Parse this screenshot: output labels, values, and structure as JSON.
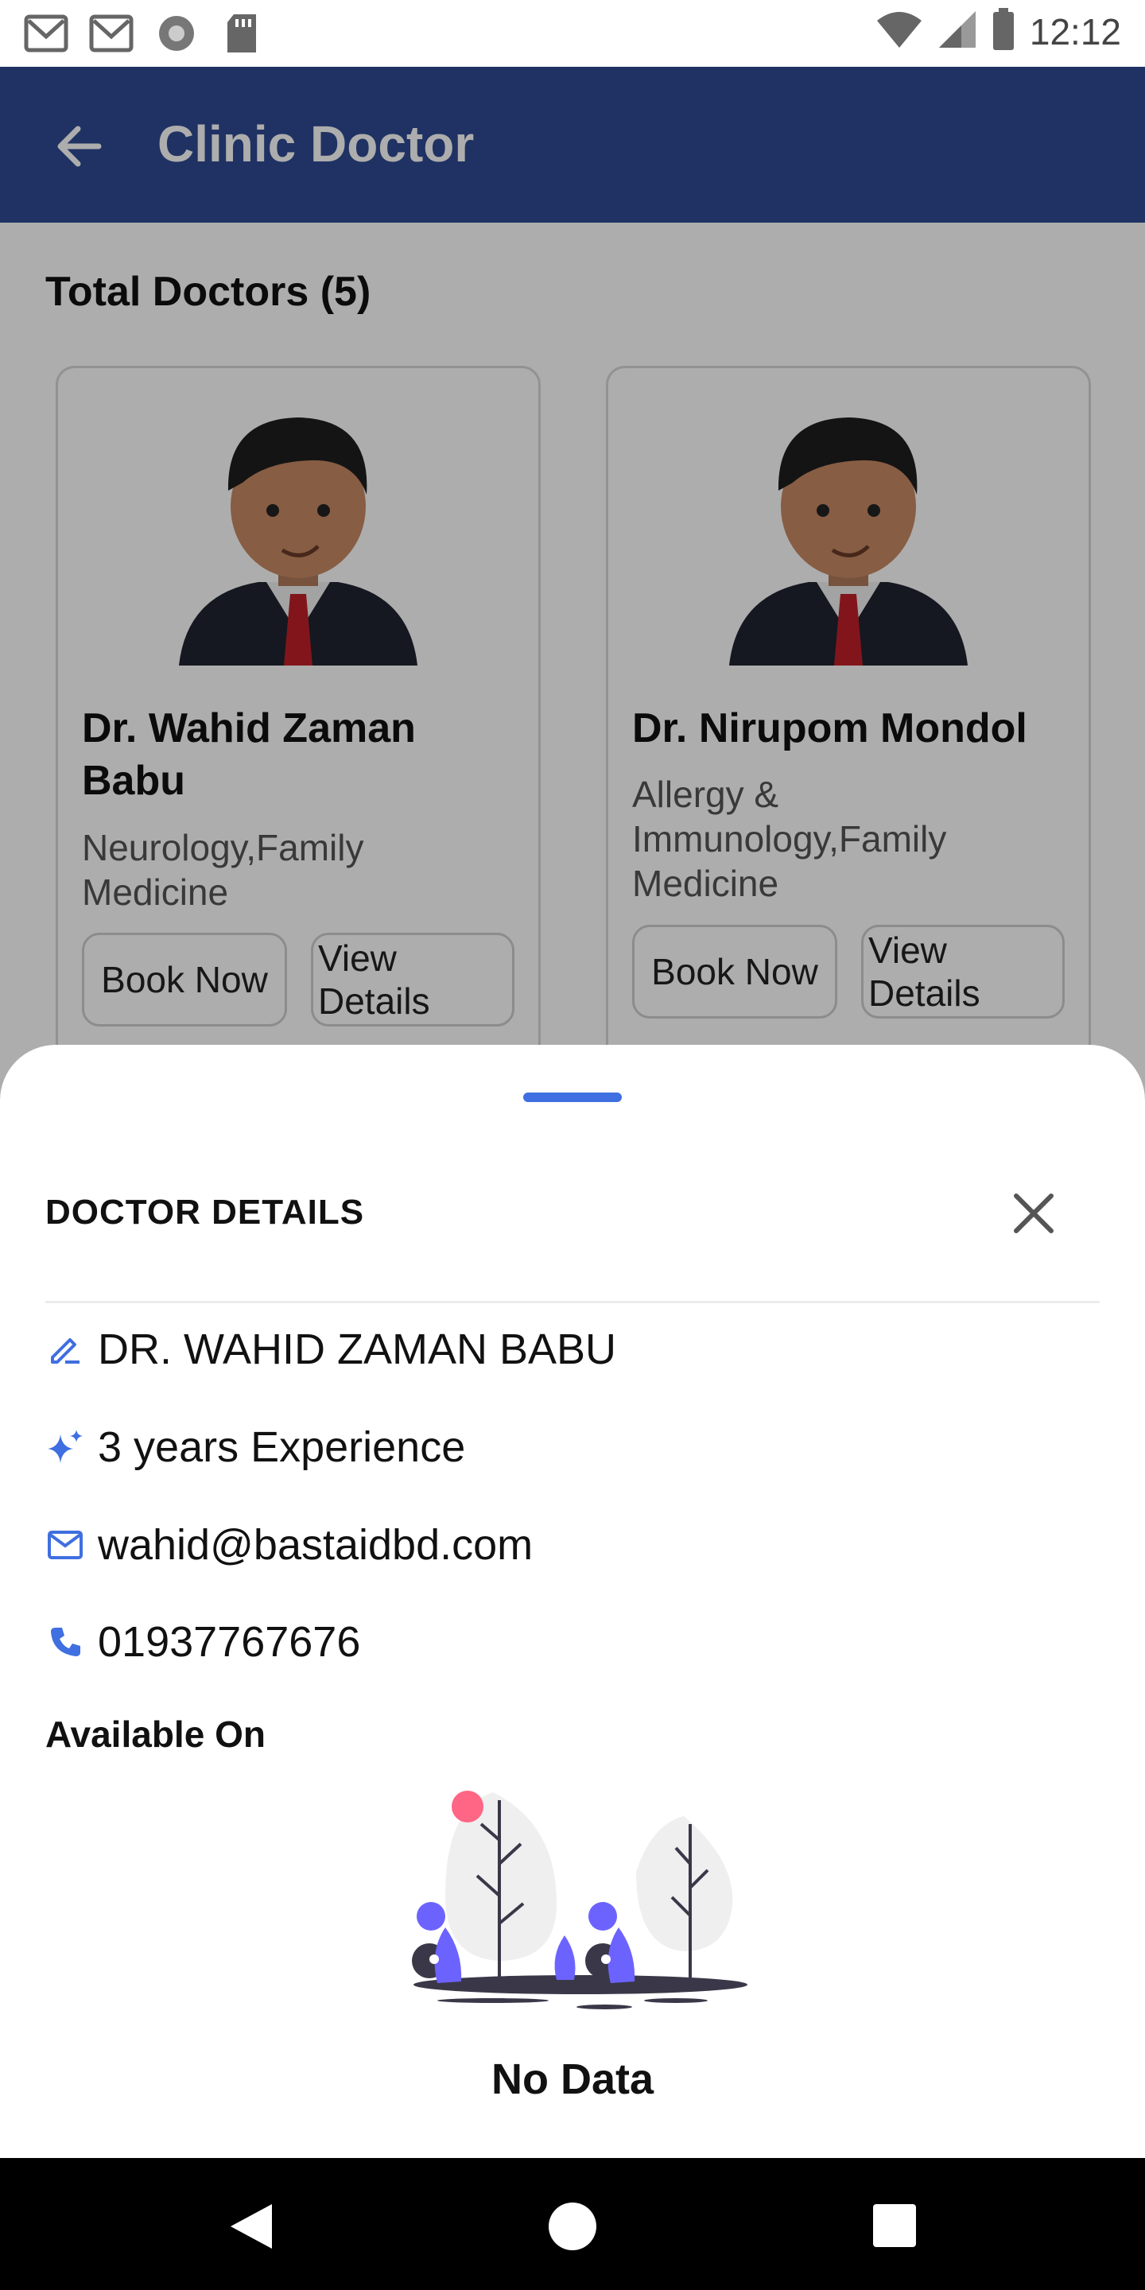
{
  "status_bar": {
    "time": "12:12"
  },
  "app_bar": {
    "title": "Clinic Doctor"
  },
  "content": {
    "total_label": "Total Doctors (5)",
    "doctors": [
      {
        "name": "Dr. Wahid Zaman Babu",
        "specialty": "Neurology,Family Medicine",
        "book_label": "Book Now",
        "view_label": "View Details"
      },
      {
        "name": "Dr. Nirupom Mondol",
        "specialty": "Allergy & Immunology,Family Medicine",
        "book_label": "Book Now",
        "view_label": "View Details"
      }
    ]
  },
  "sheet": {
    "title": "DOCTOR DETAILS",
    "name": "DR. WAHID ZAMAN BABU",
    "experience": "3 years Experience",
    "email": "wahid@bastaidbd.com",
    "phone": "01937767676",
    "available_label": "Available On",
    "empty_text": "No Data"
  },
  "colors": {
    "accent": "#3f6fe0",
    "app_bar": "#2e4a92",
    "illustration_purple": "#6c63ff",
    "illustration_pink": "#ff6584"
  },
  "icons": [
    "mail-icon",
    "mail-icon",
    "sync-icon",
    "sd-card-icon",
    "wifi-icon",
    "signal-icon",
    "battery-icon",
    "back-arrow-icon",
    "close-icon",
    "edit-icon",
    "sparkle-icon",
    "mail-icon",
    "phone-icon"
  ]
}
